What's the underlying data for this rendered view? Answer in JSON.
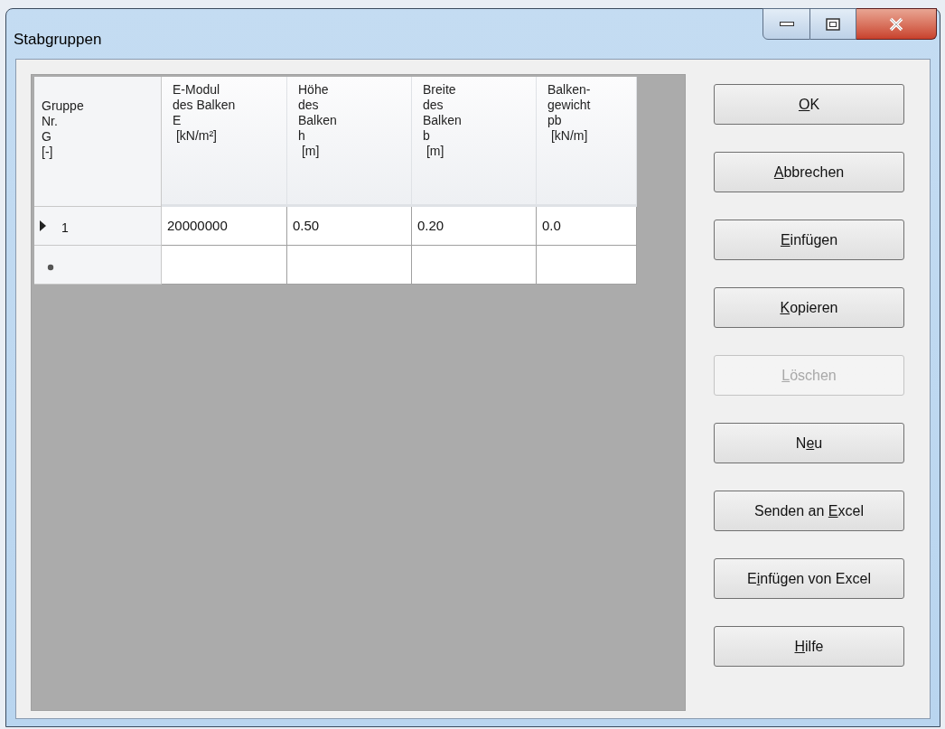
{
  "window": {
    "title": "Stabgruppen"
  },
  "grid": {
    "row_header_title": [
      "Gruppe",
      "Nr.",
      "G",
      "[-]"
    ],
    "columns": [
      {
        "lines": [
          "E-Modul",
          "des Balken",
          "E",
          " [kN/m²]"
        ]
      },
      {
        "lines": [
          "Höhe",
          "des",
          "Balken",
          "h",
          " [m]"
        ]
      },
      {
        "lines": [
          "Breite",
          "des",
          "Balken",
          "b",
          " [m]"
        ]
      },
      {
        "lines": [
          "Balken-",
          "gewicht",
          "pb",
          " [kN/m]"
        ]
      }
    ],
    "rows": [
      {
        "kind": "current",
        "header": "1",
        "cells": [
          "20000000",
          "0.50",
          "0.20",
          "0.0"
        ]
      },
      {
        "kind": "new"
      }
    ]
  },
  "buttons": [
    {
      "key": "O",
      "after": "K",
      "disabled": false
    },
    {
      "key": "A",
      "after": "bbrechen",
      "disabled": false
    },
    {
      "key": "E",
      "after": "infügen",
      "disabled": false
    },
    {
      "key": "K",
      "after": "opieren",
      "disabled": false
    },
    {
      "key": "L",
      "after": "öschen",
      "disabled": true
    },
    {
      "before": "N",
      "key": "e",
      "after": "u",
      "disabled": false
    },
    {
      "before": "Senden an ",
      "key": "E",
      "after": "xcel",
      "disabled": false
    },
    {
      "before": "E",
      "key": "i",
      "after": "nfügen von Excel",
      "disabled": false
    },
    {
      "key": "H",
      "after": "ilfe",
      "disabled": false
    }
  ]
}
